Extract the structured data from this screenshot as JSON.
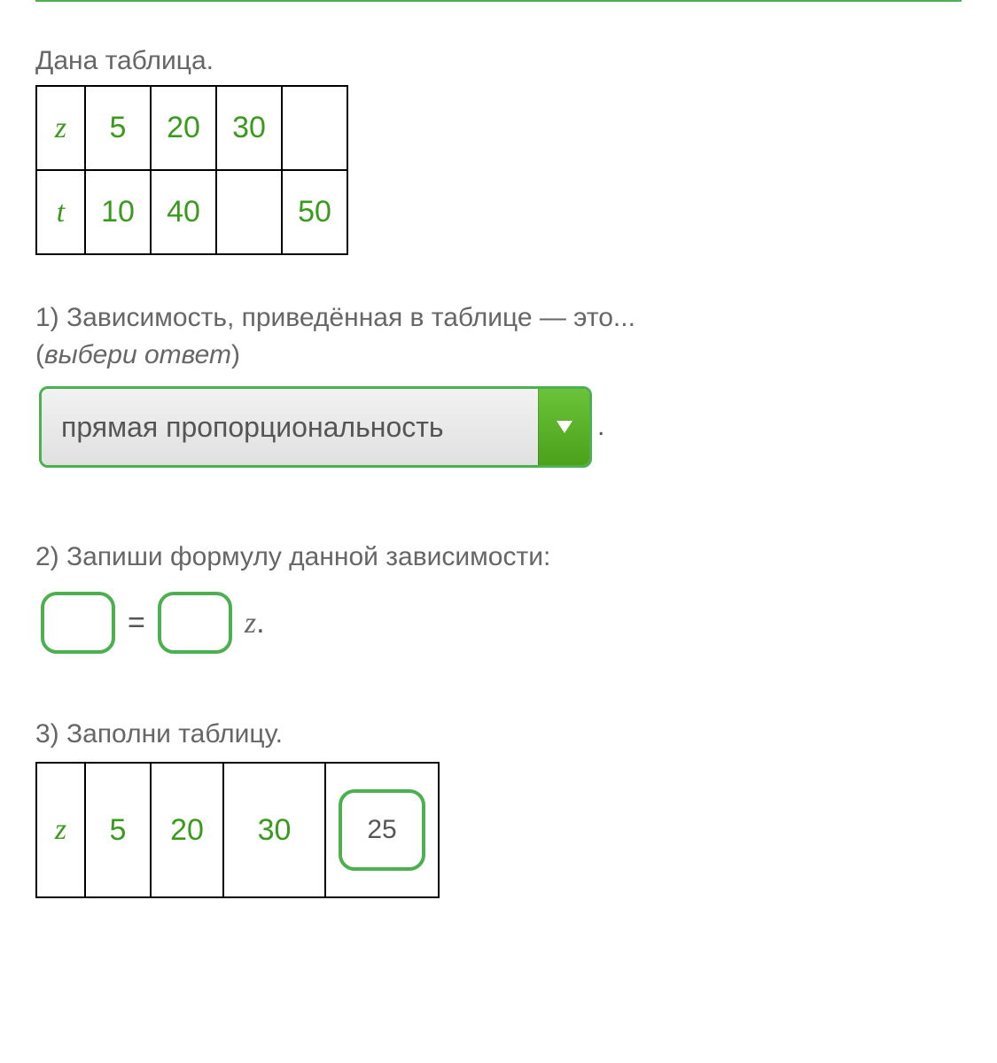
{
  "intro": "Дана таблица.",
  "given_table": {
    "rows": [
      {
        "label": "z",
        "cells": [
          "5",
          "20",
          "30",
          ""
        ]
      },
      {
        "label": "t",
        "cells": [
          "10",
          "40",
          "",
          "50"
        ]
      }
    ]
  },
  "q1": {
    "text": "1) Зависимость, приведённая в таблице — это...",
    "hint_open": "(",
    "hint_italic": "выбери ответ",
    "hint_close": ")",
    "selected": "прямая пропорциональность",
    "period": "."
  },
  "q2": {
    "text": "2) Запиши формулу данной зависимости:",
    "left_value": "",
    "eq": "=",
    "right_value": "",
    "var": "z",
    "period": "."
  },
  "q3": {
    "text": "3) Заполни таблицу.",
    "row": {
      "label": "z",
      "cells": [
        "5",
        "20",
        "30"
      ],
      "input": "25"
    }
  },
  "colors": {
    "accent": "#4caf50",
    "value": "#3a9a1e"
  }
}
